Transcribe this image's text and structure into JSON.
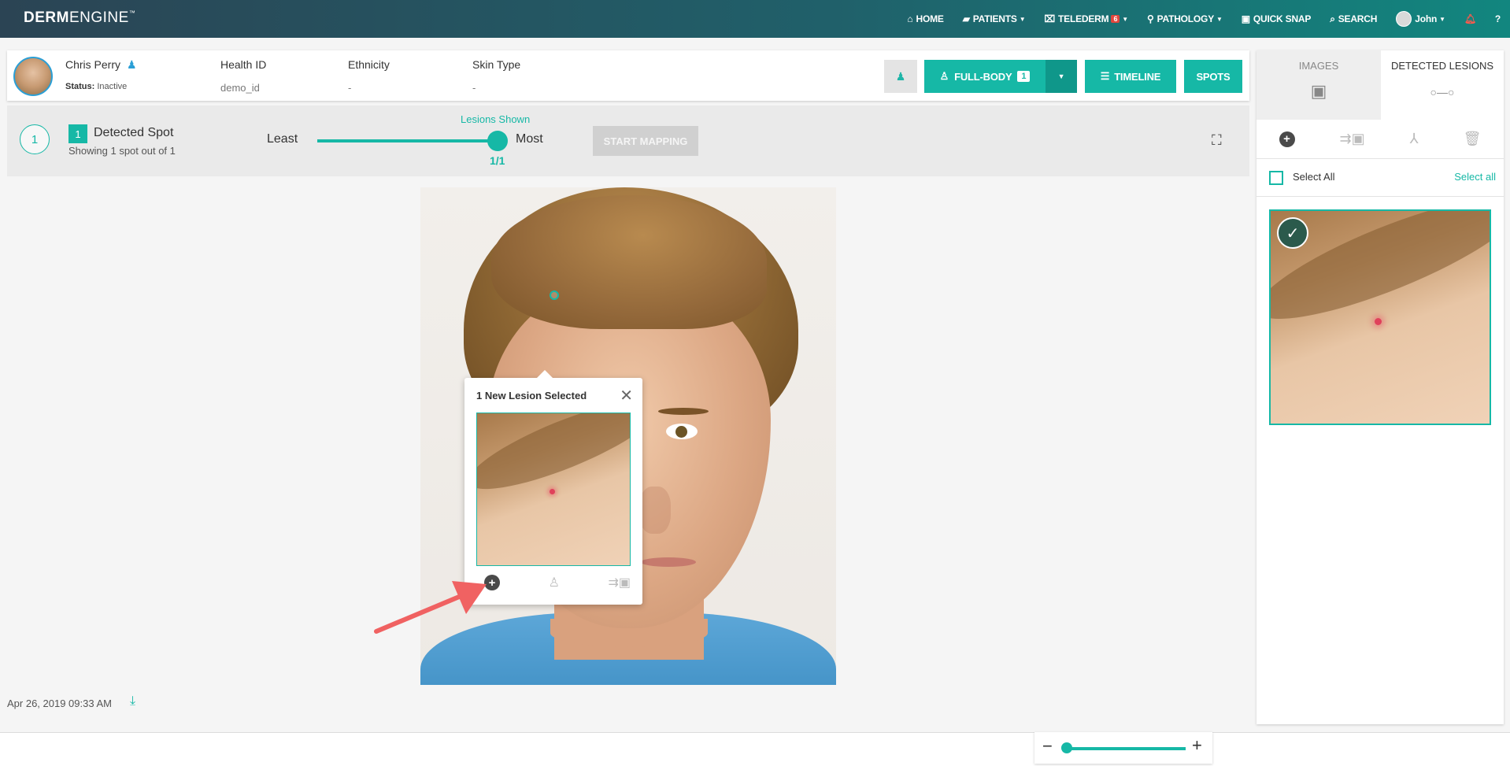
{
  "app": {
    "logo_bold": "DERM",
    "logo_light": "ENGINE",
    "logo_tm": "™"
  },
  "nav": {
    "home": "HOME",
    "patients": "PATIENTS",
    "telederm": "TELEDERM",
    "telederm_badge": "6",
    "pathology": "PATHOLOGY",
    "quick_snap": "QUICK SNAP",
    "search": "SEARCH",
    "user": "John"
  },
  "patient": {
    "name": "Chris Perry",
    "status_label": "Status:",
    "status_value": "Inactive",
    "health_id_label": "Health ID",
    "health_id_value": "demo_id",
    "ethnicity_label": "Ethnicity",
    "ethnicity_value": "-",
    "skin_type_label": "Skin Type",
    "skin_type_value": "-"
  },
  "actions": {
    "full_body": "FULL-BODY",
    "full_body_count": "1",
    "timeline": "TIMELINE",
    "spots": "SPOTS"
  },
  "spot_bar": {
    "circle_number": "1",
    "square_number": "1",
    "title": "Detected Spot",
    "subtitle": "Showing 1 spot out of 1",
    "least": "Least",
    "most": "Most",
    "lesions_shown": "Lesions Shown",
    "fraction": "1/1",
    "start_mapping": "START MAPPING"
  },
  "popup": {
    "title": "1 New Lesion Selected"
  },
  "footer": {
    "date": "Apr 26, 2019 09:33 AM"
  },
  "side": {
    "tab_images": "IMAGES",
    "tab_lesions": "DETECTED LESIONS",
    "select_all_label": "Select All",
    "select_all_link": "Select all"
  },
  "zoom": {
    "level": 0
  },
  "colors": {
    "accent": "#16b8a6",
    "header_start": "#2b4454",
    "header_end": "#12867f",
    "badge": "#e2463c"
  }
}
